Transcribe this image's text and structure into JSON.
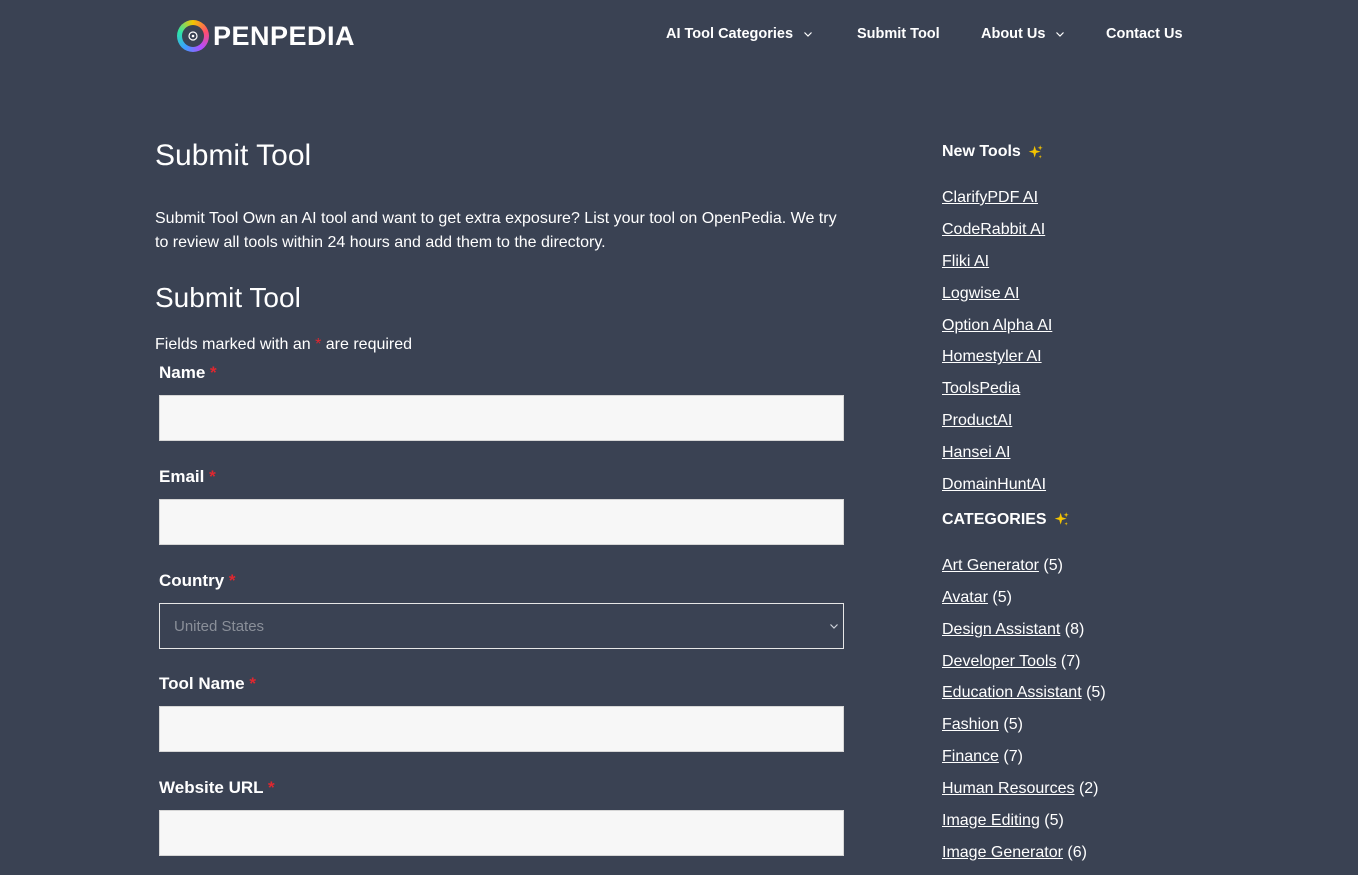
{
  "header": {
    "logo_text": "PENPEDIA",
    "nav": [
      {
        "label": "AI Tool Categories",
        "has_dropdown": true
      },
      {
        "label": "Submit Tool",
        "has_dropdown": false
      },
      {
        "label": "About Us",
        "has_dropdown": true
      },
      {
        "label": "Contact Us",
        "has_dropdown": false
      }
    ]
  },
  "main": {
    "page_title": "Submit Tool",
    "intro": "Submit Tool Own an AI tool and want to get extra exposure? List your tool on OpenPedia. We try to review all tools within 24 hours and add them to the directory.",
    "form_title": "Submit Tool",
    "required_note_before": "Fields marked with an",
    "required_star": "*",
    "required_note_after": "are required",
    "fields": [
      {
        "label": "Name",
        "value": "",
        "type": "text"
      },
      {
        "label": "Email",
        "value": "",
        "type": "text"
      },
      {
        "label": "Country",
        "value": "United States",
        "type": "select"
      },
      {
        "label": "Tool Name",
        "value": "",
        "type": "text"
      },
      {
        "label": "Website URL",
        "value": "",
        "type": "text"
      }
    ]
  },
  "sidebar": {
    "new_tools_title": "New Tools",
    "new_tools": [
      "ClarifyPDF AI",
      "CodeRabbit AI",
      "Fliki AI",
      "Logwise AI",
      "Option Alpha AI",
      "Homestyler AI",
      "ToolsPedia",
      "ProductAI",
      "Hansei AI",
      "DomainHuntAI"
    ],
    "categories_title": "CATEGORIES",
    "categories": [
      {
        "name": "Art Generator",
        "count": "(5)"
      },
      {
        "name": "Avatar",
        "count": "(5)"
      },
      {
        "name": "Design Assistant",
        "count": "(8)"
      },
      {
        "name": "Developer Tools",
        "count": "(7)"
      },
      {
        "name": "Education Assistant",
        "count": "(5)"
      },
      {
        "name": "Fashion",
        "count": "(5)"
      },
      {
        "name": "Finance",
        "count": "(7)"
      },
      {
        "name": "Human Resources",
        "count": "(2)"
      },
      {
        "name": "Image Editing",
        "count": "(5)"
      },
      {
        "name": "Image Generator",
        "count": "(6)"
      }
    ]
  },
  "colors": {
    "background": "#3a4253",
    "required": "#e0272f",
    "input_bg": "#f7f7f7",
    "sparkle": "#f4c400"
  }
}
